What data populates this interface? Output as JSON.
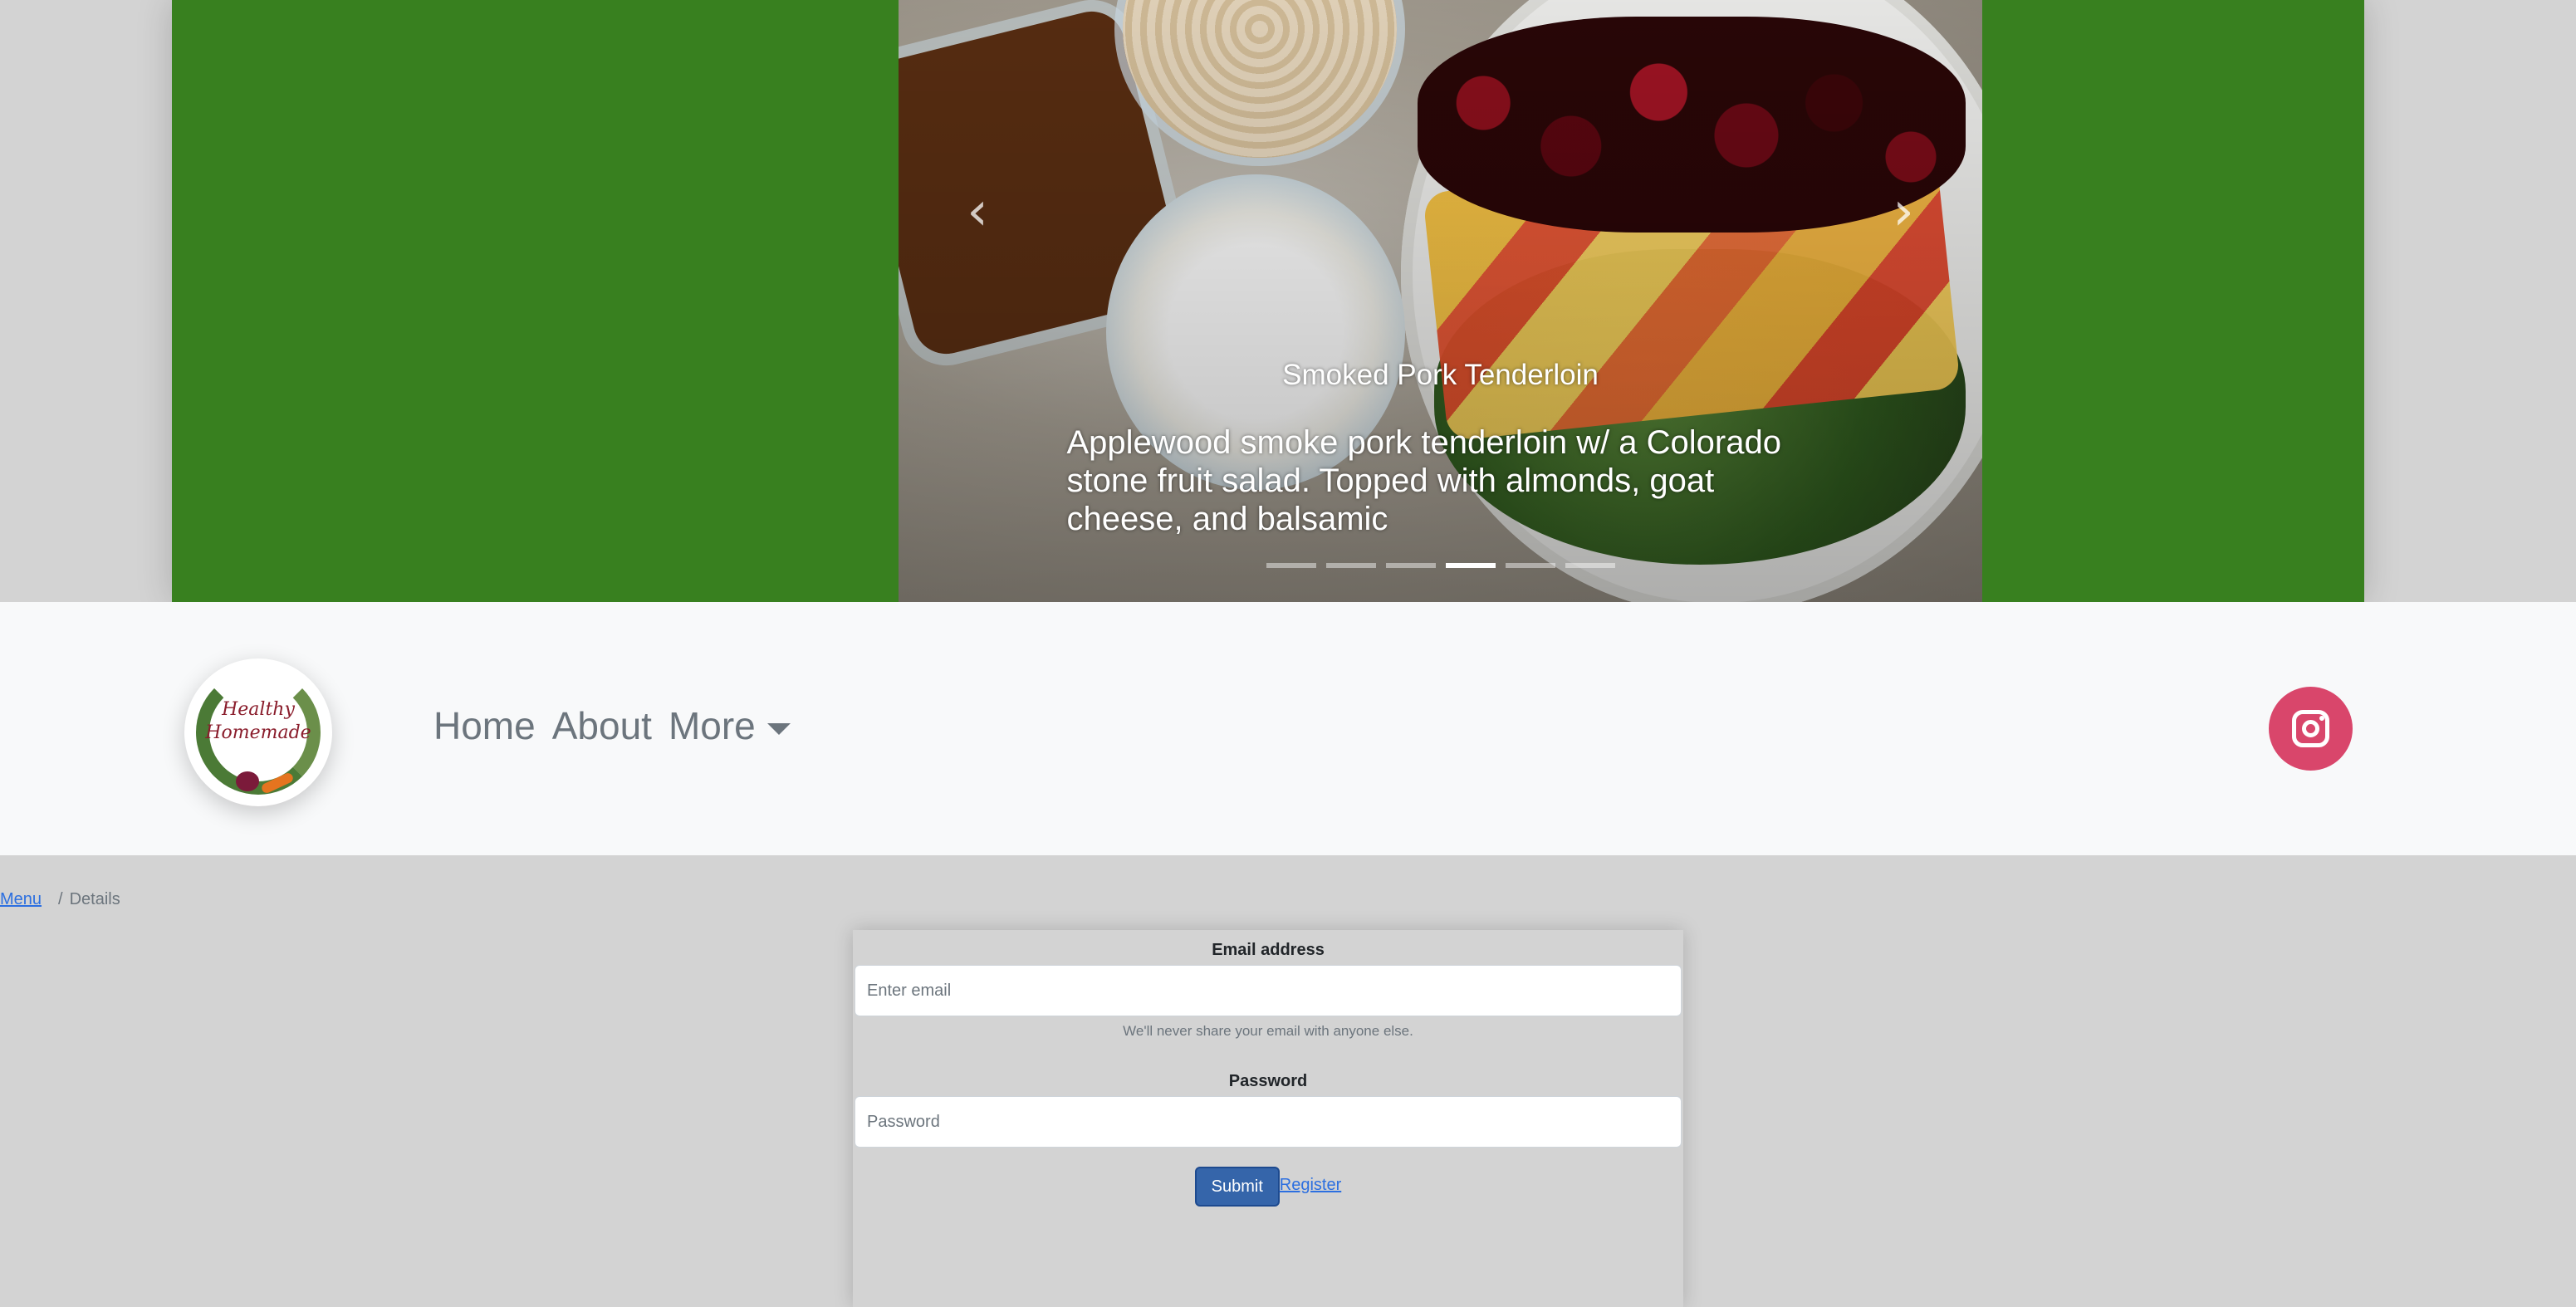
{
  "carousel": {
    "prev_icon": "chevron-left-icon",
    "next_icon": "chevron-right-icon",
    "prev_glyph": "‹",
    "next_glyph": "›",
    "caption_title": "Smoked Pork Tenderloin",
    "caption_text": "Applewood smoke pork tenderloin w/ a Colorado stone fruit salad. Topped with almonds, goat cheese, and balsamic",
    "slide_count": 6,
    "active_slide": 4
  },
  "navbar": {
    "logo_text_line1": "Healthy",
    "logo_text_line2": "Homemade",
    "links": [
      "Home",
      "About",
      "More"
    ],
    "instagram_icon": "instagram-icon",
    "instagram_color": "#d9466b"
  },
  "breadcrumb": {
    "link": "Menu",
    "separator": "/",
    "current": "Details"
  },
  "form": {
    "email_label": "Email address",
    "email_placeholder": "Enter email",
    "email_help": "We'll never share your email with anyone else.",
    "password_label": "Password",
    "password_placeholder": "Password",
    "submit_label": "Submit",
    "register_label": "Register"
  },
  "colors": {
    "hero_background": "#38801f",
    "page_background": "#d3d3d3",
    "submit_button": "#3565aa",
    "link": "#2c6fe0"
  }
}
